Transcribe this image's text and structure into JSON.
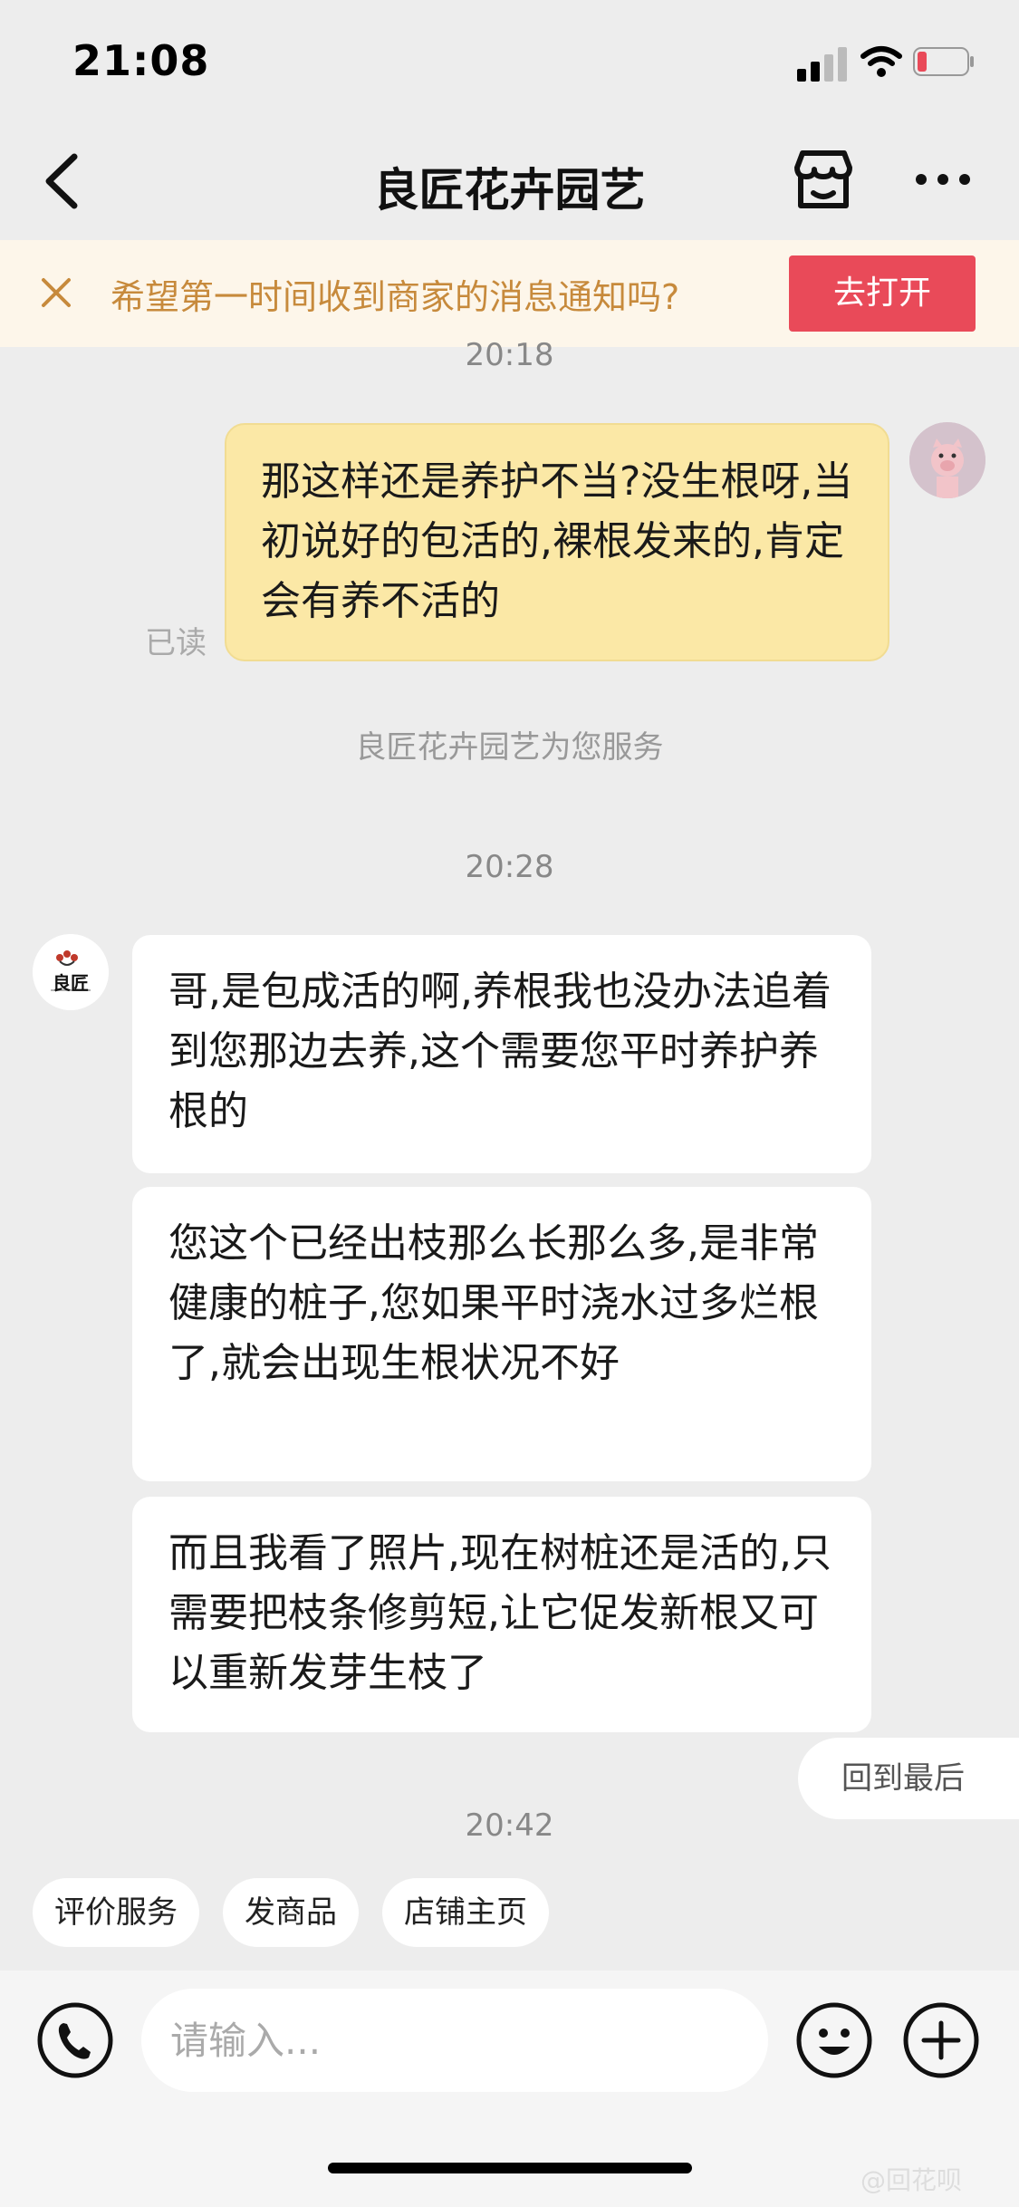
{
  "status_bar": {
    "time": "21:08"
  },
  "nav": {
    "title": "良匠花卉园艺"
  },
  "notify": {
    "text": "希望第一时间收到商家的消息通知吗?",
    "button": "去打开"
  },
  "timestamps": {
    "cut": "20:18",
    "t1": "20:28",
    "t2": "20:42"
  },
  "messages": {
    "outgoing": "那这样还是养护不当?没生根呀,当初说好的包活的,裸根发来的,肯定会有养不活的",
    "read_label": "已读",
    "service_note": "良匠花卉园艺为您服务",
    "shop_avatar_text": "良匠",
    "incoming": [
      "哥,是包成活的啊,养根我也没办法追着到您那边去养,这个需要您平时养护养根的",
      "您这个已经出枝那么长那么多,是非常健康的桩子,您如果平时浇水过多烂根了,就会出现生根状况不好",
      "而且我看了照片,现在树桩还是活的,只需要把枝条修剪短,让它促发新根又可以重新发芽生枝了"
    ]
  },
  "back_to_last": "回到最后",
  "quick_actions": [
    "评价服务",
    "发商品",
    "店铺主页"
  ],
  "input": {
    "placeholder": "请输入..."
  },
  "watermark": "@回花呗",
  "icons": [
    "chevron-left-icon",
    "shop-icon",
    "more-icon",
    "close-icon",
    "voice-icon",
    "emoji-icon",
    "plus-icon"
  ],
  "colors": {
    "accent": "#e94a59",
    "bubble_out": "#fbe8a6",
    "notify_text": "#c78a3c"
  }
}
